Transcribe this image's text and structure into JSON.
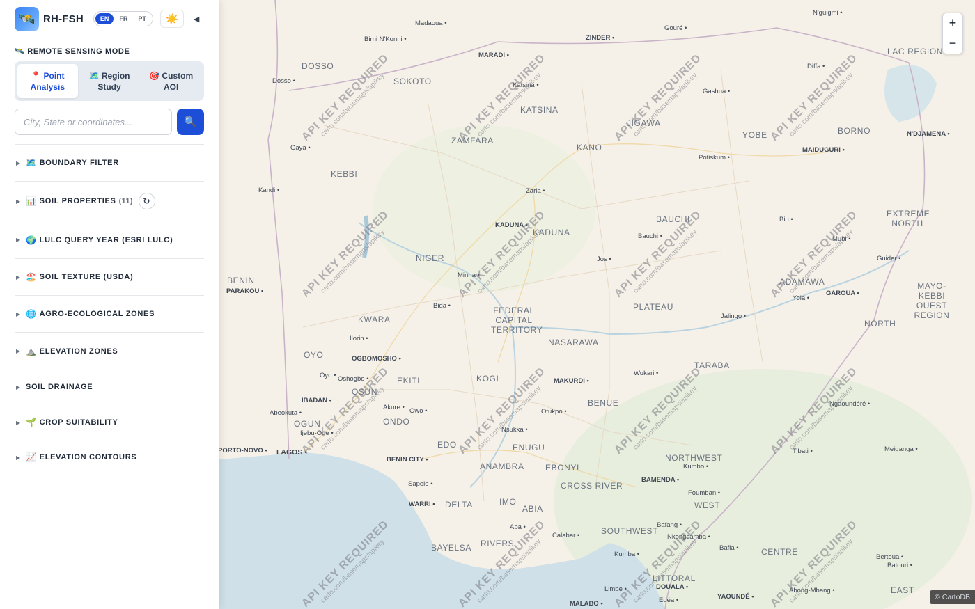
{
  "app": {
    "brand": "RH-FSH",
    "logo_icon": "🛰️",
    "languages": [
      "EN",
      "FR",
      "PT"
    ],
    "active_language": "EN",
    "theme_icon": "☀️",
    "collapse_icon": "◀"
  },
  "mode": {
    "label": "REMOTE SENSING MODE",
    "label_icon": "🛰️",
    "tabs": [
      {
        "icon": "📍",
        "line1": "Point",
        "line2": "Analysis",
        "active": true
      },
      {
        "icon": "🗺️",
        "line1": "Region",
        "line2": "Study",
        "active": false
      },
      {
        "icon": "🎯",
        "line1": "Custom",
        "line2": "AOI",
        "active": false
      }
    ]
  },
  "search": {
    "placeholder": "City, State or coordinates...",
    "button_icon": "🔍"
  },
  "sections": [
    {
      "icon": "🗺️",
      "label": "BOUNDARY FILTER"
    },
    {
      "icon": "📊",
      "label": "SOIL PROPERTIES",
      "count": "(11)",
      "refresh": "↻"
    },
    {
      "icon": "🌍",
      "label": "LULC QUERY YEAR (ESRI LULC)"
    },
    {
      "icon": "🏖️",
      "label": "SOIL TEXTURE (USDA)"
    },
    {
      "icon": "🌐",
      "label": "AGRO-ECOLOGICAL ZONES"
    },
    {
      "icon": "⛰️",
      "label": "ELEVATION ZONES"
    },
    {
      "icon": "",
      "label": "SOIL DRAINAGE"
    },
    {
      "icon": "🌱",
      "label": "CROP SUITABILITY"
    },
    {
      "icon": "📈",
      "label": "ELEVATION CONTOURS"
    }
  ],
  "map": {
    "watermark_main": "API KEY REQUIRED",
    "watermark_sub": "carto.com/basemaps/apikey",
    "zoom_in": "+",
    "zoom_out": "−",
    "attribution": "© CartoDB",
    "regions": [
      "DOSSO",
      "SOKOTO",
      "KATSINA",
      "ZAMFARA",
      "JIGAWA",
      "KANO",
      "YOBE",
      "BORNO",
      "KEBBI",
      "BAUCHI",
      "KADUNA",
      "EXTREME NORTH",
      "NIGER",
      "BENIN",
      "PLATEAU",
      "ADAMAWA",
      "FEDERAL CAPITAL TERRITORY",
      "KWARA",
      "NASARAWA",
      "NORTH",
      "OYO",
      "EKITI",
      "KOGI",
      "TARABA",
      "OSUN",
      "BENUE",
      "OGUN",
      "ONDO",
      "EDO",
      "ENUGU",
      "ANAMBRA",
      "EBONYI",
      "NORTHWEST",
      "CROSS RIVER",
      "DELTA",
      "IMO",
      "ABIA",
      "WEST",
      "BAYELSA",
      "RIVERS",
      "SOUTHWEST",
      "CENTRE",
      "LITTORAL",
      "EAST",
      "LAC REGION",
      "MAYO-KEBBI OUEST REGION"
    ],
    "cities": [
      "Madaoua",
      "N'guigmi",
      "Birni N'Konni",
      "Gouré",
      "ZINDER",
      "MARADI",
      "Diffa",
      "Katsina",
      "Gashua",
      "N'DJAMENA",
      "Gaya",
      "Potiskum",
      "MAIDUGURI",
      "Kandi",
      "Zaria",
      "Biu",
      "KADUNA",
      "Bauchi",
      "Mubi",
      "Guider",
      "PARAKOU",
      "Minna",
      "Jos",
      "Yola",
      "GAROUA",
      "Bida",
      "Jalingo",
      "Ilorin",
      "OGBOMOSHO",
      "Oyo",
      "Oshogbo",
      "Wukari",
      "IBADAN",
      "MAKURDI",
      "Akure",
      "Owo",
      "Ngaoundéré",
      "Abeokuta",
      "Otukpo",
      "Ijebu-Ode",
      "Nsukka",
      "Meiganga",
      "LAGOS",
      "BENIN CITY",
      "Tibati",
      "Kumbo",
      "BAMENDA",
      "Sapele",
      "Foumban",
      "WARRI",
      "Aba",
      "Bafang",
      "Nkongsamba",
      "Calabar",
      "Bafia",
      "Bertoua",
      "Kumba",
      "Batouri",
      "DOUALA",
      "Abong-Mbang",
      "YAOUNDÉ",
      "Limbe",
      "MALABO",
      "Edéa",
      "PORTO-NOVO",
      "Dosso"
    ]
  }
}
